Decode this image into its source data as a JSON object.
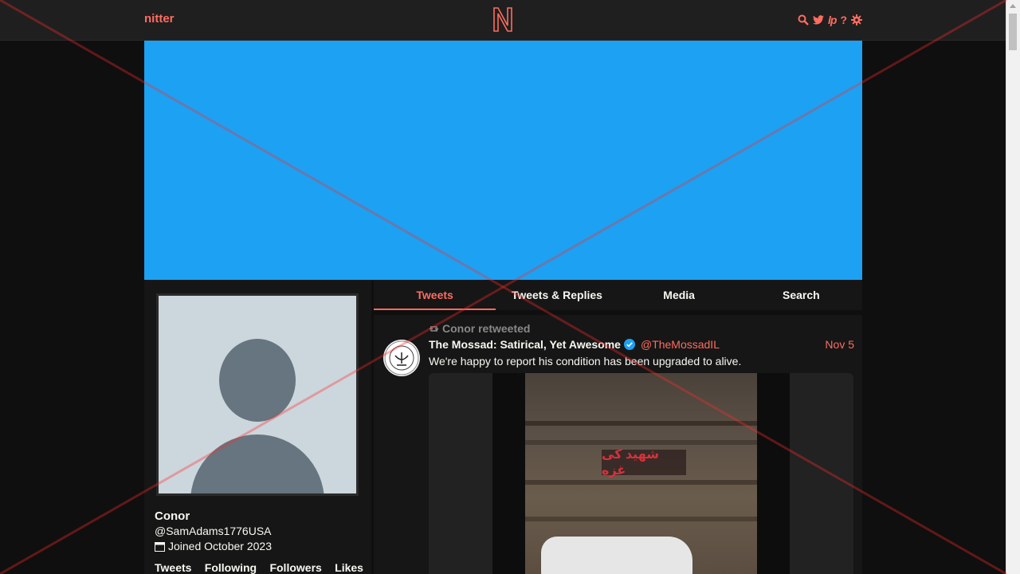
{
  "nav": {
    "brand": "nitter",
    "logo_letter": "N",
    "icons": [
      "search-icon",
      "twitter-bird-icon",
      "lp-icon",
      "help-icon",
      "settings-gear-icon"
    ],
    "help_glyph": "?",
    "lp_glyph": "lp"
  },
  "colors": {
    "accent": "#ff6c60",
    "banner": "#1da1f2",
    "background": "#0f0f0f",
    "panel": "#161616",
    "verified": "#1da1f2"
  },
  "profile": {
    "name": "Conor",
    "handle": "@SamAdams1776USA",
    "joined": "Joined October 2023",
    "stats": [
      "Tweets",
      "Following",
      "Followers",
      "Likes"
    ]
  },
  "tabs": [
    {
      "label": "Tweets",
      "active": true
    },
    {
      "label": "Tweets & Replies",
      "active": false
    },
    {
      "label": "Media",
      "active": false
    },
    {
      "label": "Search",
      "active": false
    }
  ],
  "tweet": {
    "retweet_label": "Conor retweeted",
    "fullname": "The Mossad: Satirical, Yet Awesome",
    "verified": true,
    "username": "@TheMossadIL",
    "date": "Nov 5",
    "text": "We're happy to report his condition has been upgraded to alive.",
    "media_caption": "شهید کی غزه"
  }
}
